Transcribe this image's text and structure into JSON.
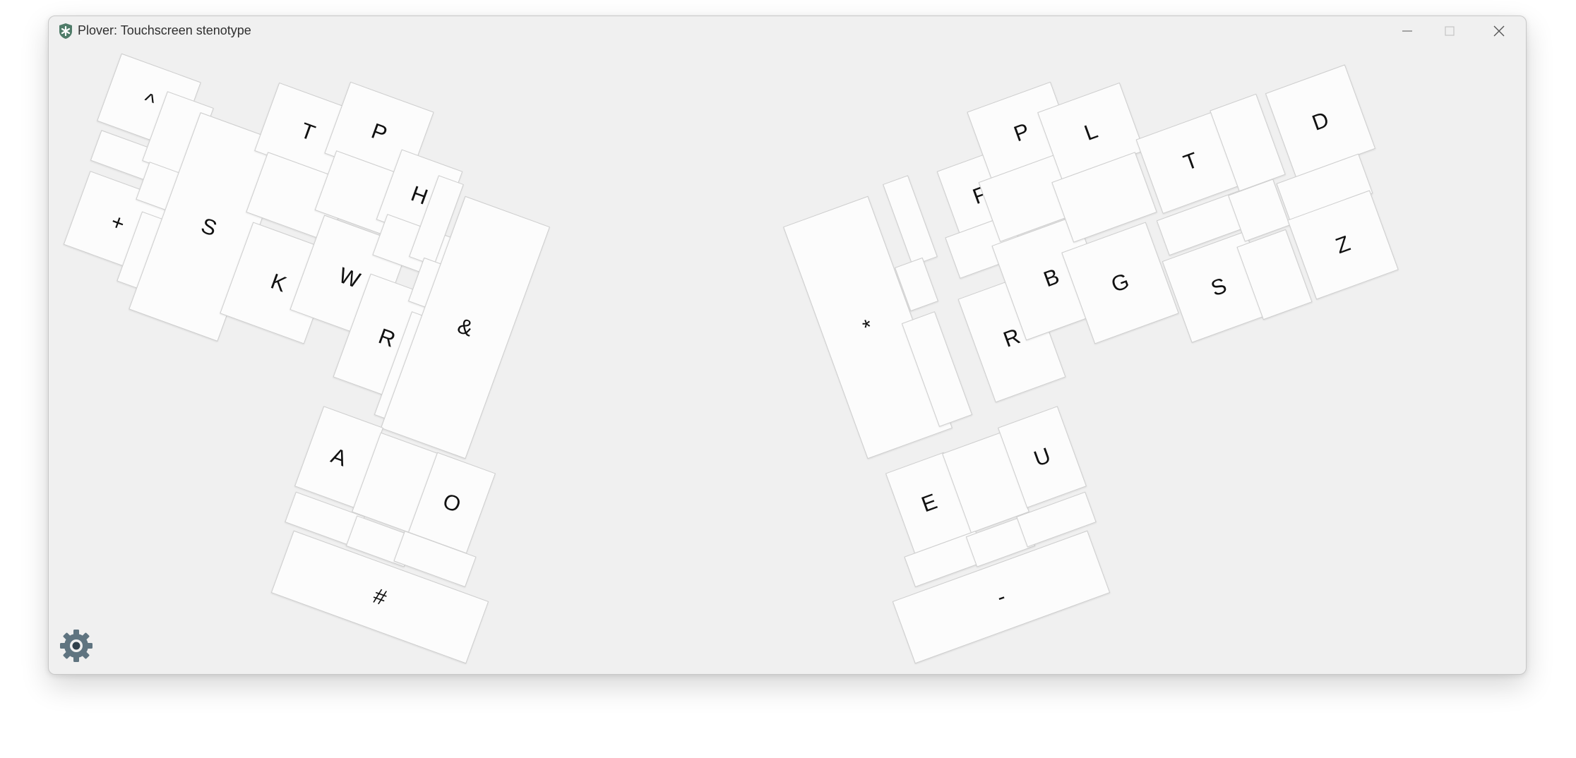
{
  "window": {
    "title": "Plover: Touchscreen stenotype"
  },
  "colors": {
    "window_bg": "#f0f0f0",
    "key_bg": "#fcfcfc",
    "settings_icon": "#5f7480"
  },
  "icons": {
    "app": "plover-star-icon",
    "minimize": "minimize-icon",
    "maximize": "maximize-icon",
    "close": "close-icon",
    "settings": "gear-icon"
  },
  "keys": {
    "caret": "^",
    "plus": "+",
    "left_s": "S",
    "left_t": "T",
    "left_k": "K",
    "left_p": "P",
    "left_w": "W",
    "left_h": "H",
    "left_r": "R",
    "ampersand": "&",
    "vowel_a": "A",
    "vowel_o": "O",
    "number": "#",
    "star": "*",
    "right_f": "F",
    "right_r": "R",
    "right_p": "P",
    "right_b": "B",
    "right_l": "L",
    "right_g": "G",
    "right_t": "T",
    "right_s": "S",
    "right_d": "D",
    "right_z": "Z",
    "vowel_e": "E",
    "vowel_u": "U",
    "dash": "-"
  }
}
